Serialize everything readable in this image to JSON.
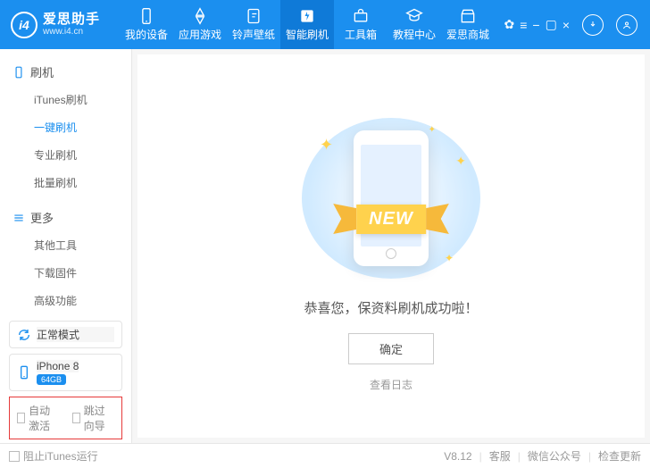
{
  "brand": {
    "name": "爱思助手",
    "url": "www.i4.cn",
    "logo_text": "i4"
  },
  "nav": [
    {
      "label": "我的设备"
    },
    {
      "label": "应用游戏"
    },
    {
      "label": "铃声壁纸"
    },
    {
      "label": "智能刷机",
      "active": true
    },
    {
      "label": "工具箱"
    },
    {
      "label": "教程中心"
    },
    {
      "label": "爱思商城"
    }
  ],
  "sidebar": {
    "groups": [
      {
        "title": "刷机",
        "items": [
          {
            "label": "iTunes刷机"
          },
          {
            "label": "一键刷机",
            "active": true
          },
          {
            "label": "专业刷机"
          },
          {
            "label": "批量刷机"
          }
        ]
      },
      {
        "title": "更多",
        "items": [
          {
            "label": "其他工具"
          },
          {
            "label": "下载固件"
          },
          {
            "label": "高级功能"
          }
        ]
      }
    ],
    "mode": "正常模式",
    "device": {
      "name": "iPhone 8",
      "storage": "64GB"
    },
    "options": {
      "auto_activate": "自动激活",
      "skip_guide": "跳过向导"
    }
  },
  "main": {
    "ribbon": "NEW",
    "message": "恭喜您，保资料刷机成功啦！",
    "ok": "确定",
    "log": "查看日志"
  },
  "footer": {
    "block_itunes": "阻止iTunes运行",
    "version": "V8.12",
    "links": [
      "客服",
      "微信公众号",
      "检查更新"
    ]
  }
}
